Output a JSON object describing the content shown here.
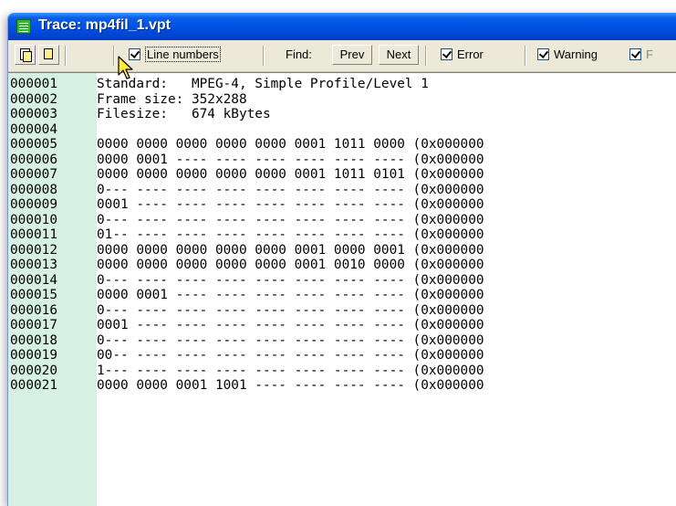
{
  "window": {
    "title": "Trace: mp4fil_1.vpt"
  },
  "toolbar": {
    "line_numbers_label": "Line numbers",
    "find_label": "Find:",
    "prev_label": "Prev",
    "next_label": "Next",
    "error_label": "Error",
    "warning_label": "Warning",
    "trailing_label": "F",
    "line_numbers_checked": true,
    "error_checked": true,
    "warning_checked": true,
    "trailing_checked": true
  },
  "trace": {
    "rows": [
      {
        "num": "000001",
        "text": "Standard:   MPEG-4, Simple Profile/Level 1"
      },
      {
        "num": "000002",
        "text": "Frame size: 352x288"
      },
      {
        "num": "000003",
        "text": "Filesize:   674 kBytes"
      },
      {
        "num": "000004",
        "text": ""
      },
      {
        "num": "000005",
        "text": "0000 0000 0000 0000 0000 0001 1011 0000 (0x000000"
      },
      {
        "num": "000006",
        "text": "0000 0001 ---- ---- ---- ---- ---- ---- (0x000000"
      },
      {
        "num": "000007",
        "text": "0000 0000 0000 0000 0000 0001 1011 0101 (0x000000"
      },
      {
        "num": "000008",
        "text": "0--- ---- ---- ---- ---- ---- ---- ---- (0x000000"
      },
      {
        "num": "000009",
        "text": "0001 ---- ---- ---- ---- ---- ---- ---- (0x000000"
      },
      {
        "num": "000010",
        "text": "0--- ---- ---- ---- ---- ---- ---- ---- (0x000000"
      },
      {
        "num": "000011",
        "text": "01-- ---- ---- ---- ---- ---- ---- ---- (0x000000"
      },
      {
        "num": "000012",
        "text": "0000 0000 0000 0000 0000 0001 0000 0001 (0x000000"
      },
      {
        "num": "000013",
        "text": "0000 0000 0000 0000 0000 0001 0010 0000 (0x000000"
      },
      {
        "num": "000014",
        "text": "0--- ---- ---- ---- ---- ---- ---- ---- (0x000000"
      },
      {
        "num": "000015",
        "text": "0000 0001 ---- ---- ---- ---- ---- ---- (0x000000"
      },
      {
        "num": "000016",
        "text": "0--- ---- ---- ---- ---- ---- ---- ---- (0x000000"
      },
      {
        "num": "000017",
        "text": "0001 ---- ---- ---- ---- ---- ---- ---- (0x000000"
      },
      {
        "num": "000018",
        "text": "0--- ---- ---- ---- ---- ---- ---- ---- (0x000000"
      },
      {
        "num": "000019",
        "text": "00-- ---- ---- ---- ---- ---- ---- ---- (0x000000"
      },
      {
        "num": "000020",
        "text": "1--- ---- ---- ---- ---- ---- ---- ---- (0x000000"
      },
      {
        "num": "000021",
        "text": "0000 0000 0001 1001 ---- ---- ---- ---- (0x000000"
      }
    ]
  }
}
